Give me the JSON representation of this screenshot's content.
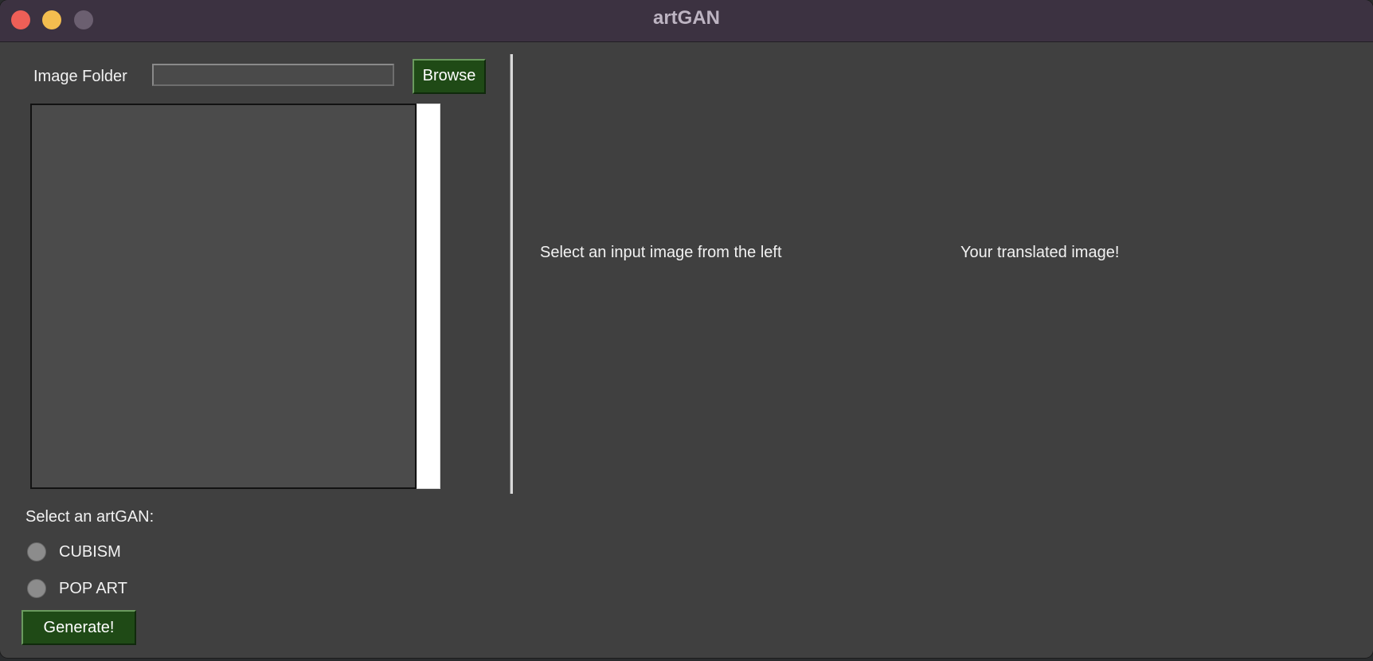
{
  "window": {
    "title": "artGAN"
  },
  "left_panel": {
    "folder_label": "Image Folder",
    "folder_value": "",
    "browse_label": "Browse",
    "image_list": [],
    "select_label": "Select an artGAN:",
    "options": [
      {
        "label": "CUBISM",
        "selected": false
      },
      {
        "label": "POP ART",
        "selected": false
      }
    ],
    "generate_label": "Generate!"
  },
  "right_panel": {
    "input_caption": "Select an input image from the left",
    "output_caption": "Your translated image!"
  },
  "colors": {
    "window_bg": "#404040",
    "titlebar_bg": "#3c3241",
    "button_bg": "#1f4a16",
    "close": "#ee5f57",
    "minimize": "#f3bd4f",
    "maximize_inactive": "#6b5f70"
  }
}
